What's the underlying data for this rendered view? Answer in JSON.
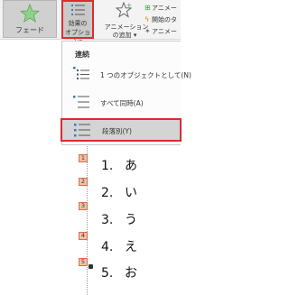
{
  "ribbon": {
    "fade_label": "フェード",
    "effect_options_line1": "効果の",
    "effect_options_line2": "オプション▾",
    "add_animation_line1": "アニメーション",
    "add_animation_line2": "の追加 ▾",
    "side_commands": [
      "アニメー",
      "開始のタ",
      "アニメー"
    ]
  },
  "dropdown": {
    "header": "連続",
    "items": [
      {
        "label": "1 つのオブジェクトとして(N)",
        "icon": "single-object-icon"
      },
      {
        "label": "すべて同時(A)",
        "icon": "all-at-once-icon"
      },
      {
        "label": "段落別(Y)",
        "icon": "by-paragraph-icon",
        "selected": true
      }
    ]
  },
  "slide": {
    "items": [
      {
        "badge": "1",
        "num": "1.",
        "text": "あ"
      },
      {
        "badge": "2",
        "num": "2.",
        "text": "い"
      },
      {
        "badge": "3",
        "num": "3.",
        "text": "う"
      },
      {
        "badge": "4",
        "num": "4.",
        "text": "え"
      },
      {
        "badge": "5",
        "num": "5.",
        "text": "お"
      }
    ]
  },
  "colors": {
    "highlight": "#e0282f",
    "badge_fill": "#f4c0a4",
    "ribbon_bg": "#f3f3f3",
    "star_green": "#3aa13a"
  }
}
